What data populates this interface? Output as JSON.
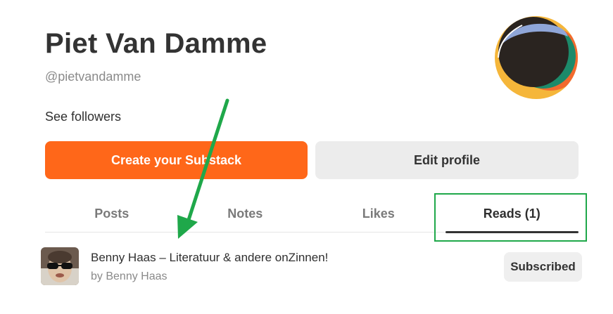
{
  "profile": {
    "name": "Piet Van Damme",
    "handle": "@pietvandamme",
    "followers_link": "See followers"
  },
  "actions": {
    "create_label": "Create your Substack",
    "edit_label": "Edit profile"
  },
  "tabs": [
    {
      "label": "Posts",
      "active": false
    },
    {
      "label": "Notes",
      "active": false
    },
    {
      "label": "Likes",
      "active": false
    },
    {
      "label": "Reads (1)",
      "active": true
    }
  ],
  "reads": [
    {
      "title": "Benny Haas – Literatuur & andere onZinnen!",
      "author": "by Benny Haas",
      "button": "Subscribed"
    }
  ],
  "colors": {
    "brand": "#ff6719",
    "annotation": "#1fa84a"
  },
  "icons": {
    "avatar": "profile-avatar-image",
    "thumbnail": "publication-thumbnail-image"
  }
}
